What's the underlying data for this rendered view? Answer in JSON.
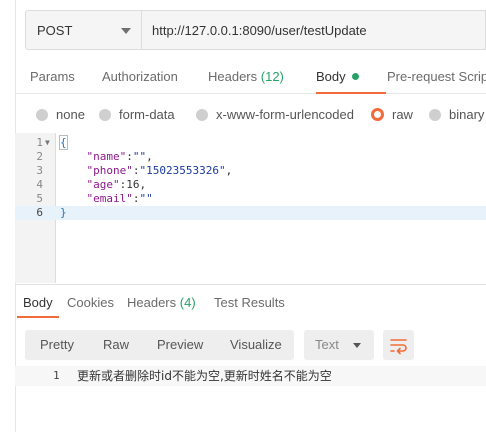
{
  "request": {
    "method": "POST",
    "url": "http://127.0.0.1:8090/user/testUpdate"
  },
  "request_tabs": {
    "params": "Params",
    "authorization": "Authorization",
    "headers_label": "Headers",
    "headers_count": "(12)",
    "body": "Body",
    "prerequest": "Pre-request Script"
  },
  "body_types": {
    "none": "none",
    "form_data": "form-data",
    "urlencoded": "x-www-form-urlencoded",
    "raw": "raw",
    "binary": "binary",
    "selected": "raw"
  },
  "editor": {
    "lines": [
      {
        "n": "1",
        "text": "{"
      },
      {
        "n": "2",
        "key": "\"name\"",
        "value": "\"\""
      },
      {
        "n": "3",
        "key": "\"phone\"",
        "value": "\"15023553326\""
      },
      {
        "n": "4",
        "key": "\"age\"",
        "value": "16"
      },
      {
        "n": "5",
        "key": "\"email\"",
        "value": "\"\""
      },
      {
        "n": "6",
        "text": "}"
      }
    ]
  },
  "response_tabs": {
    "body": "Body",
    "cookies": "Cookies",
    "headers_label": "Headers",
    "headers_count": "(4)",
    "test_results": "Test Results"
  },
  "view_modes": {
    "pretty": "Pretty",
    "raw": "Raw",
    "preview": "Preview",
    "visualize": "Visualize",
    "format": "Text"
  },
  "response": {
    "line_number": "1",
    "text": "更新或者删除时id不能为空,更新时姓名不能为空"
  },
  "colors": {
    "accent": "#f26b3a",
    "count_green": "#26a269",
    "json_key": "#8b1a8b",
    "json_string": "#1a3a9e"
  },
  "icons": {
    "method_dropdown": "chevron-down-icon",
    "format_dropdown": "chevron-down-icon",
    "wrap": "wrap-lines-icon",
    "fold": "fold-arrow-icon"
  }
}
